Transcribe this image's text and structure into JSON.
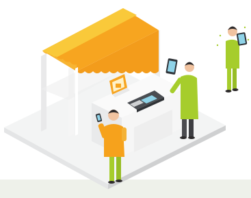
{
  "illustration": {
    "kiosk_sign_text": "",
    "colors": {
      "awning_orange": "#f7a520",
      "awning_yellow": "#f9c93a",
      "shirt_green": "#a6cd2c",
      "shirt_orange": "#f6a21c",
      "platform": "#f1f2f2",
      "platform_side": "#d9dadb",
      "kiosk_white": "#f7f7f7",
      "kiosk_shadow": "#dcdcdc",
      "pos_terminal": "#4a4d52",
      "tablet": "#2f3338",
      "skin": "#f1c3a0",
      "hair": "#2d2a2b",
      "footer_band": "#eef1ea"
    },
    "icons": [
      "pos-terminal-icon",
      "tablet-icon",
      "phone-icon",
      "calendar-sign-icon",
      "awning-icon"
    ]
  }
}
